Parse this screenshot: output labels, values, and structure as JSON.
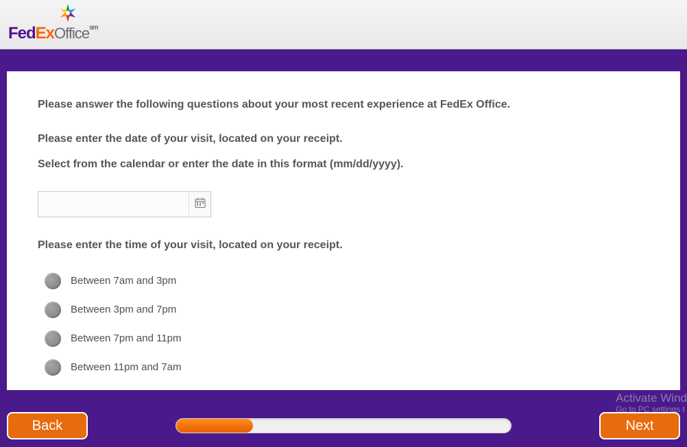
{
  "brand": {
    "fed": "Fed",
    "ex": "Ex",
    "office": "Office",
    "sm": "sm"
  },
  "intro": "Please answer the following questions about your most recent experience at FedEx Office.",
  "date_question": "Please enter the date of your visit, located on your receipt.",
  "date_hint": "Select from the calendar or enter the date in this format (mm/dd/yyyy).",
  "date_value": "",
  "time_question": "Please enter the time of your visit, located on your receipt.",
  "time_options": [
    "Between 7am and 3pm",
    "Between 3pm and 7pm",
    "Between 7pm and 11pm",
    "Between 11pm and 7am"
  ],
  "buttons": {
    "back": "Back",
    "next": "Next"
  },
  "progress_percent": 23,
  "watermark": {
    "line1": "Activate Wind",
    "line2": "Go to PC settings t"
  }
}
